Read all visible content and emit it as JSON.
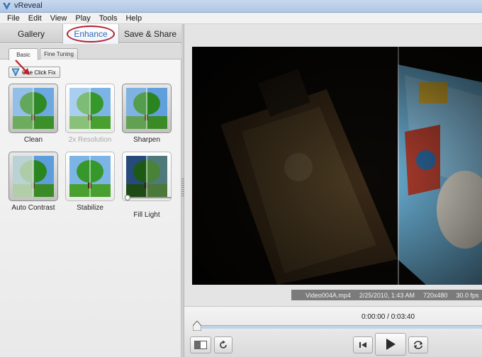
{
  "window": {
    "title": "vReveal"
  },
  "menu": [
    "File",
    "Edit",
    "View",
    "Play",
    "Tools",
    "Help"
  ],
  "main_tabs": {
    "gallery": "Gallery",
    "enhance": "Enhance",
    "save_share": "Save & Share"
  },
  "sub_tabs": {
    "basic": "Basic",
    "fine_tuning": "Fine Tuning"
  },
  "one_click_fix": "One Click Fix",
  "effects": [
    {
      "label": "Clean",
      "enabled": true
    },
    {
      "label": "2x Resolution",
      "enabled": false
    },
    {
      "label": "Sharpen",
      "enabled": true
    },
    {
      "label": "Auto Contrast",
      "enabled": true
    },
    {
      "label": "Stabilize",
      "enabled": true
    },
    {
      "label": "Fill Light",
      "enabled": true
    }
  ],
  "fill_light_level": 0.0,
  "video_info": {
    "filename": "Video004A.mp4",
    "datetime": "2/25/2010, 1:43 AM",
    "resolution": "720x480",
    "fps": "30.0 fps"
  },
  "playback": {
    "time": "0:00:00 / 0:03:40",
    "progress": 0.0
  },
  "colors": {
    "enhance_tab_text": "#2e68b4",
    "annotation_red": "#b41d2b",
    "timeline": "#bfd3e6"
  }
}
